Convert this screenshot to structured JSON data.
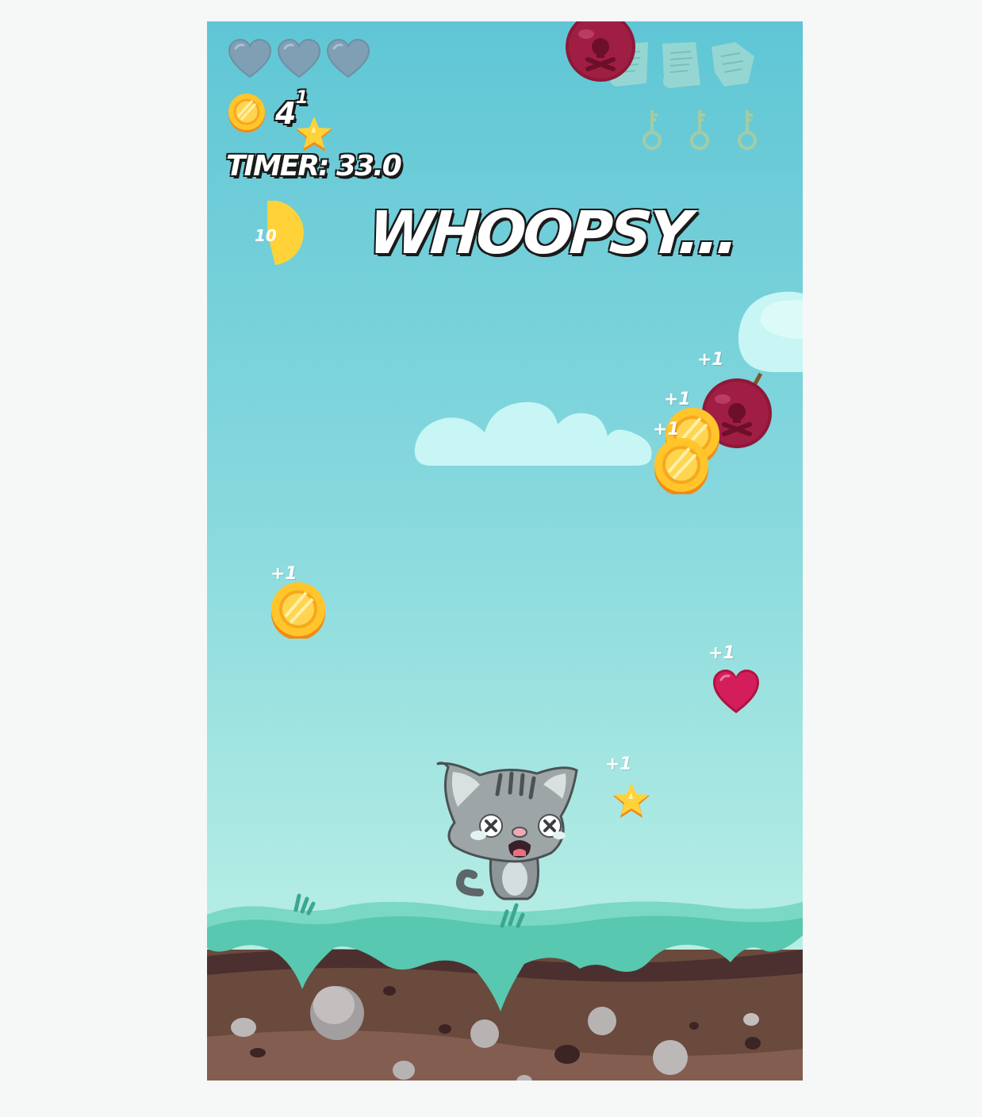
{
  "hud": {
    "hearts_remaining": 0,
    "hearts_total": 3,
    "coin_count": "4",
    "coin_count_bonus": "1",
    "timer_label": "TIMER: 33.0",
    "combo_value": "10",
    "combo_fill_fraction": 0.5,
    "scroll_pages_collected": 0,
    "scroll_pages_total": 3,
    "keys_collected": 0,
    "keys_total": 3
  },
  "banner": {
    "text": "WHOOPSY..."
  },
  "pickups": {
    "coin_a_label": "+1",
    "coin_b_label": "+1",
    "coin_c_label": "+1",
    "bomb_label": "+1",
    "heart_label": "+1",
    "star_label": "+1"
  },
  "colors": {
    "sky_top": "#5fc6d5",
    "sky_bottom": "#c4f2e6",
    "coin": "#ffc52b",
    "bomb": "#8e1838",
    "heart": "#d41e5c",
    "star": "#ffd23a",
    "grass": "#7ad8c4",
    "dirt": "#6a4a3c"
  }
}
